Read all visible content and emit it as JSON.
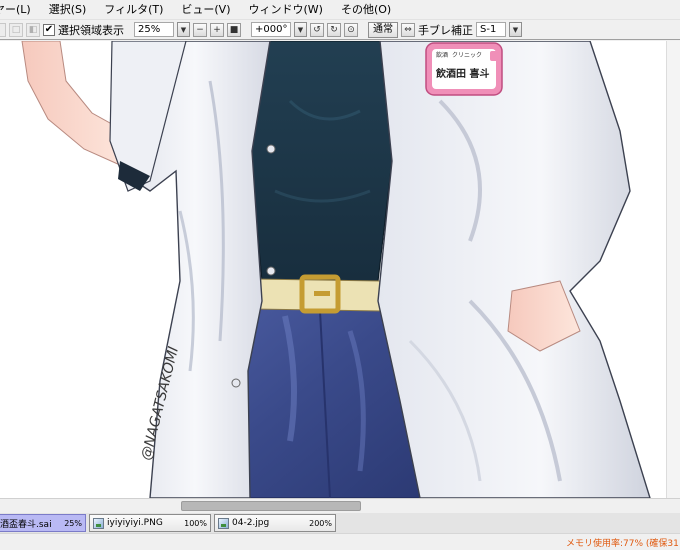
{
  "menubar": {
    "items": [
      "ヤー(L)",
      "選択(S)",
      "フィルタ(T)",
      "ビュー(V)",
      "ウィンドウ(W)",
      "その他(O)"
    ]
  },
  "toolbar": {
    "selection_visible_label": "選択領域表示",
    "selection_visible_checked": "✔",
    "zoom_value": "25%",
    "rotation_value": "+000°",
    "blend_button_label": "通常",
    "stabilizer_label": "手ブレ補正",
    "stabilizer_value": "S-1"
  },
  "canvas": {
    "name_tag_lines": [
      "飲酒",
      "クリニック",
      "飲酒田 喜斗"
    ],
    "signature": "@NAGATSAKOMI"
  },
  "tabs": [
    {
      "name": "酒盃春斗.sai",
      "zoom": "25%",
      "active": true
    },
    {
      "name": "iyiyiyiyi.PNG",
      "zoom": "100%",
      "active": false
    },
    {
      "name": "04-2.jpg",
      "zoom": "200%",
      "active": false
    }
  ],
  "status": {
    "memory_text": "メモリ使用率:77% (確保31"
  },
  "colors": {
    "active_tab": "#b9b9f4",
    "status_text": "#e05a10",
    "coat": "#f2f3f8",
    "shirt": "#1f3a4a",
    "jeans": "#3f4d8e",
    "belt": "#e9dfb0",
    "buckle": "#c9a13a",
    "name_tag": "#f08fb8"
  }
}
